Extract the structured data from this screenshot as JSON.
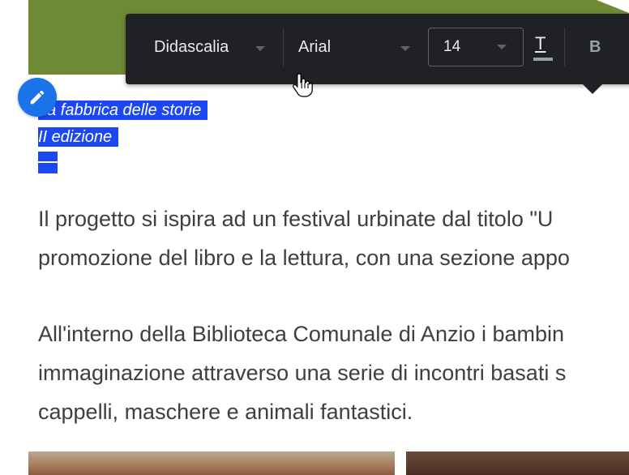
{
  "toolbar": {
    "style_label": "Didascalia",
    "font_label": "Arial",
    "size_label": "14",
    "text_color_label": "T",
    "bold_label": "B"
  },
  "caption": {
    "line1": "La fabbrica delle storie",
    "line2": "II edizione"
  },
  "body": {
    "p1_l1": "Il progetto si ispira ad un festival urbinate dal titolo \"U",
    "p1_l2": "promozione del libro e la lettura, con una sezione appo",
    "p2_l1": "All'interno della Biblioteca Comunale di Anzio i bambin",
    "p2_l2": "immaginazione attraverso una serie di incontri basati s",
    "p2_l3": "cappelli, maschere e animali fantastici."
  },
  "icons": {
    "edit": "pencil-icon",
    "cursor": "hand-pointer-icon"
  },
  "colors": {
    "toolbar_bg": "#202124",
    "selection": "#1b48f3",
    "edit_button": "#1a73e8",
    "banner": "#6e8a34"
  }
}
